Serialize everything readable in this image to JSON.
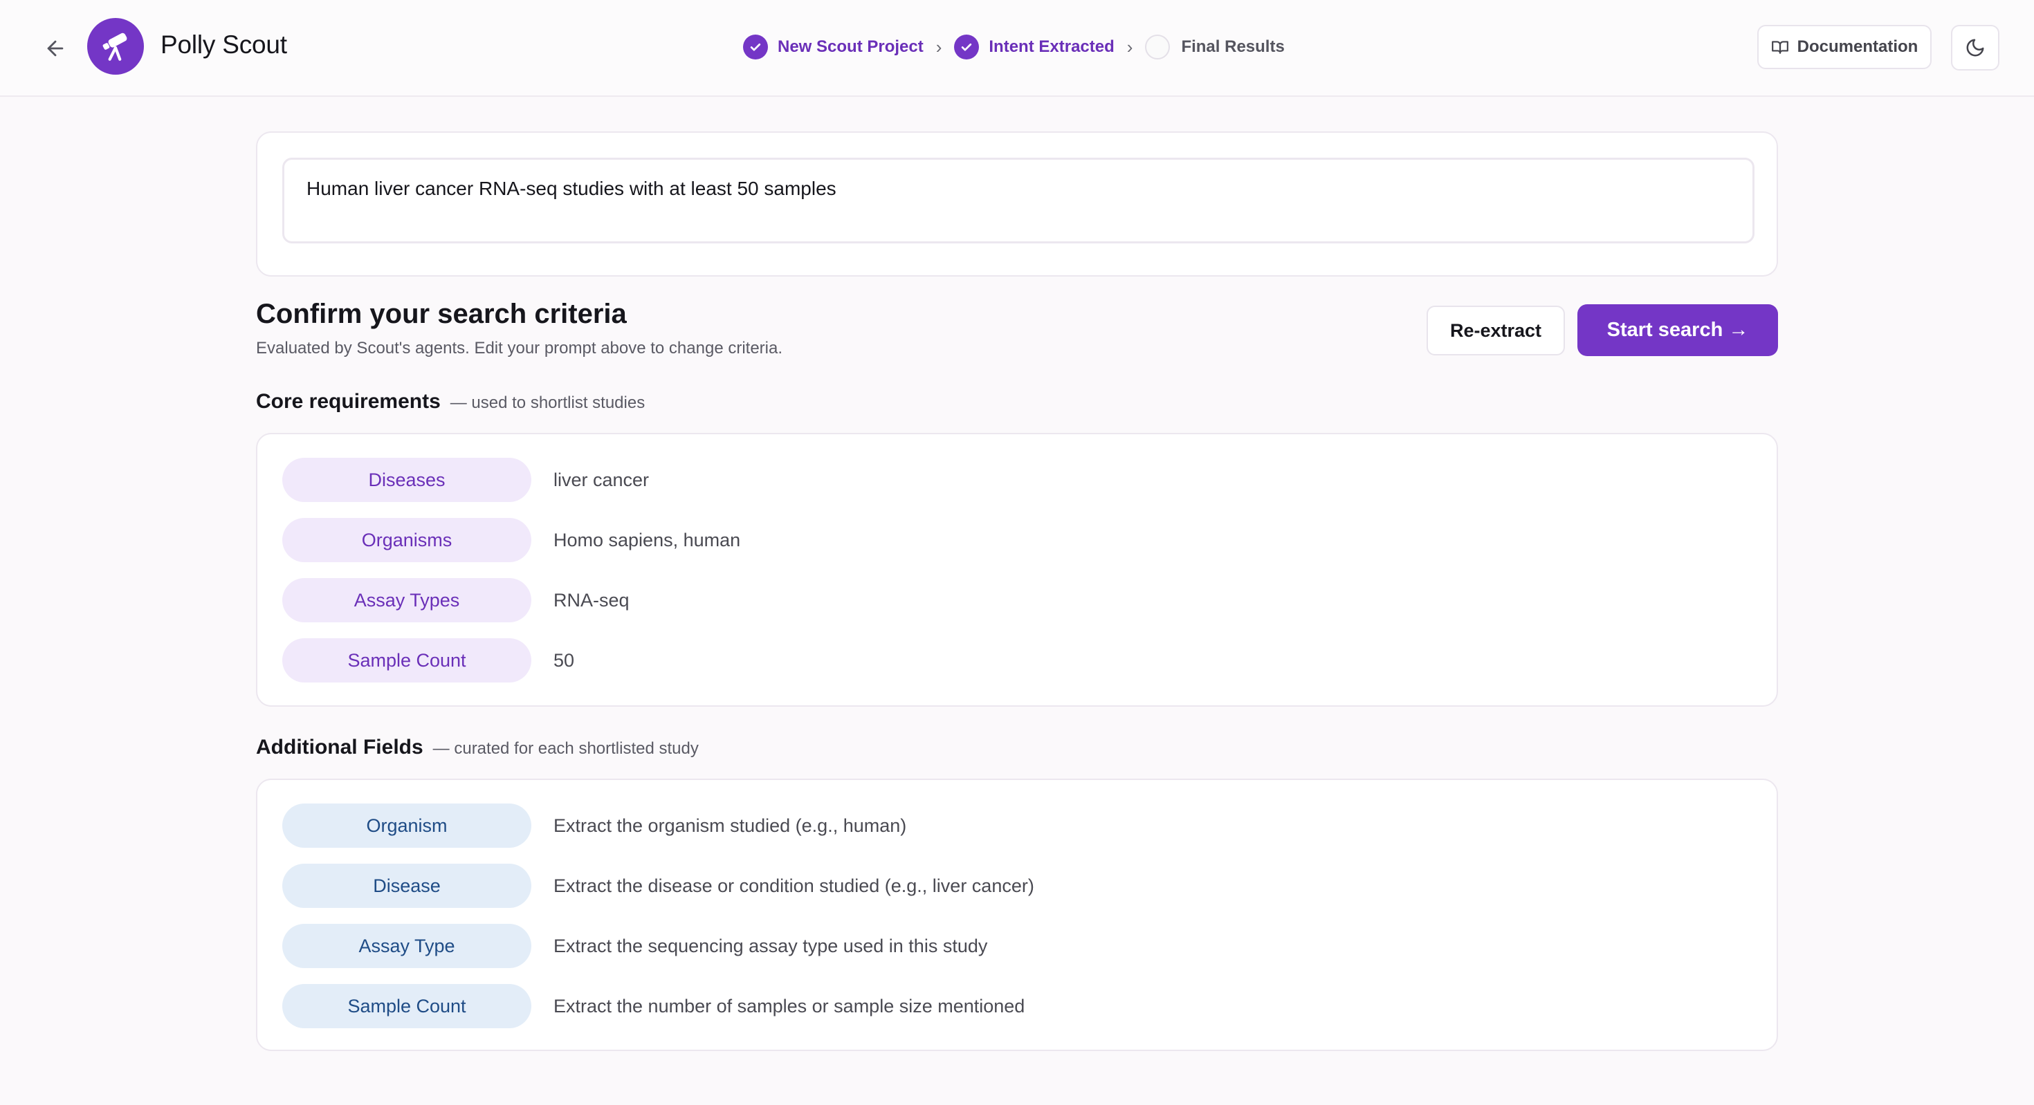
{
  "header": {
    "app_title": "Polly Scout",
    "steps": [
      {
        "label": "New Scout Project",
        "state": "done"
      },
      {
        "label": "Intent Extracted",
        "state": "done"
      },
      {
        "label": "Final Results",
        "state": "pending"
      }
    ],
    "documentation_label": "Documentation"
  },
  "prompt": {
    "value": "Human liver cancer RNA-seq studies with at least 50 samples"
  },
  "confirm": {
    "title": "Confirm your search criteria",
    "subtitle": "Evaluated by Scout's agents. Edit your prompt above to change criteria.",
    "reextract_label": "Re-extract",
    "start_label": "Start search →"
  },
  "core": {
    "title": "Core requirements",
    "note": "— used to shortlist studies",
    "rows": [
      {
        "label": "Diseases",
        "value": "liver cancer"
      },
      {
        "label": "Organisms",
        "value": "Homo sapiens, human"
      },
      {
        "label": "Assay Types",
        "value": "RNA-seq"
      },
      {
        "label": "Sample Count",
        "value": "50"
      }
    ]
  },
  "additional": {
    "title": "Additional Fields",
    "note": "— curated for each shortlisted study",
    "rows": [
      {
        "label": "Organism",
        "value": "Extract the organism studied (e.g., human)"
      },
      {
        "label": "Disease",
        "value": "Extract the disease or condition studied (e.g., liver cancer)"
      },
      {
        "label": "Assay Type",
        "value": "Extract the sequencing assay type used in this study"
      },
      {
        "label": "Sample Count",
        "value": "Extract the number of samples or sample size mentioned"
      }
    ]
  },
  "colors": {
    "accent": "#7436c6",
    "core_pill_bg": "#f1e9fb",
    "core_pill_text": "#6a2fb8",
    "extra_pill_bg": "#e3edf8",
    "extra_pill_text": "#1f4c86"
  },
  "icons": [
    "back-arrow-icon",
    "telescope-icon",
    "check-icon",
    "chevron-right-icon",
    "book-icon",
    "moon-icon"
  ]
}
